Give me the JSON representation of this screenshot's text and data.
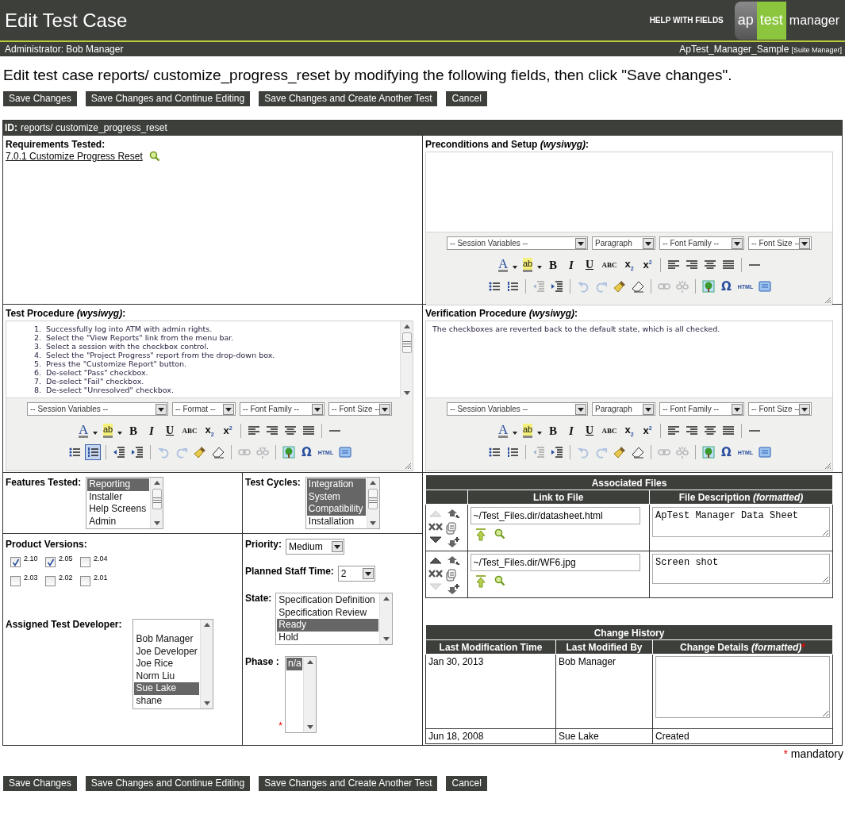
{
  "header": {
    "title": "Edit Test Case",
    "help_link": "HELP WITH FIELDS",
    "logo": [
      "ap",
      "test",
      "manager"
    ]
  },
  "user_bar": {
    "user": "Administrator: Bob Manager",
    "project": "ApTest_Manager_Sample",
    "role": "[Suite Manager]"
  },
  "instruction": "Edit test case reports/ customize_progress_reset by modifying the following fields, then click \"Save changes\".",
  "top_buttons": [
    "Save Changes",
    "Save Changes and Continue Editing",
    "Save Changes and Create Another Test",
    "Cancel"
  ],
  "form": {
    "id_label": "ID:",
    "id_value": "reports/ customize_progress_reset",
    "requirements": {
      "label": "Requirements Tested:",
      "link": "7.0.1 Customize Progress Reset"
    },
    "preconditions": {
      "label": "Preconditions and Setup *(wysiwyg)*:",
      "selects": [
        "-- Session Variables --",
        "Paragraph",
        "-- Font Family --",
        "-- Font Size --"
      ],
      "toolbar_rows": [
        [
          [
            {
              "kind": "color",
              "text": "A",
              "disabled": false,
              "active": false
            },
            {
              "kind": "highlight",
              "text": "ab",
              "disabled": false,
              "active": false
            },
            {
              "kind": "bold",
              "text": "B",
              "disabled": false,
              "active": false
            },
            {
              "kind": "italic",
              "text": "I",
              "disabled": false,
              "active": false
            },
            {
              "kind": "underline",
              "text": "U",
              "disabled": false,
              "active": false
            },
            {
              "kind": "strike",
              "text": "ABC",
              "disabled": false,
              "active": false
            },
            {
              "kind": "sub",
              "text": "x$_{2}$",
              "disabled": false,
              "active": false
            },
            {
              "kind": "sup",
              "text": "x$^{2}$",
              "disabled": false,
              "active": false
            }
          ],
          [
            {
              "kind": "left",
              "disabled": false,
              "active": false
            },
            {
              "kind": "right",
              "disabled": false,
              "active": false
            },
            {
              "kind": "center",
              "disabled": false,
              "active": false
            },
            {
              "kind": "justify",
              "disabled": false,
              "active": false
            }
          ],
          [
            {
              "kind": "rule",
              "disabled": false,
              "active": false
            }
          ]
        ],
        [
          [
            {
              "kind": "bullets",
              "disabled": false,
              "active": false
            },
            {
              "kind": "numbers",
              "disabled": false,
              "active": false
            }
          ],
          [
            {
              "kind": "outdent",
              "disabled": true,
              "active": false
            },
            {
              "kind": "indent",
              "disabled": false,
              "active": false
            }
          ],
          [
            {
              "kind": "undo",
              "disabled": true,
              "active": false
            },
            {
              "kind": "redo",
              "disabled": true,
              "active": false
            },
            {
              "kind": "cleanup",
              "disabled": false,
              "active": false
            },
            {
              "kind": "erase",
              "disabled": false,
              "active": false
            }
          ],
          [
            {
              "kind": "link",
              "disabled": true,
              "active": false
            },
            {
              "kind": "unlink",
              "disabled": true,
              "active": false
            }
          ],
          [
            {
              "kind": "image",
              "disabled": false,
              "active": false
            },
            {
              "kind": "symbol",
              "text": "Ω",
              "disabled": false,
              "active": false
            },
            {
              "kind": "html",
              "text": "HTML",
              "disabled": false,
              "active": false
            },
            {
              "kind": "fullscreen",
              "disabled": false,
              "active": false
            }
          ]
        ]
      ]
    },
    "test_procedure": {
      "label": "Test Procedure *(wysiwyg)*:",
      "steps": [
        {
          "number": "1.",
          "text": "Successfully log into ATM with admin rights."
        },
        {
          "number": "2.",
          "text": "Select the \"View Reports\" link from the menu bar."
        },
        {
          "number": "3.",
          "text": "Select a session with the checkbox control."
        },
        {
          "number": "4.",
          "text": "Select the \"Project Progress\" report from the drop-down box."
        },
        {
          "number": "5.",
          "text": "Press the \"Customize Report\" button."
        },
        {
          "number": "6.",
          "text": "De-select \"Pass\" checkbox."
        },
        {
          "number": "7.",
          "text": "De-select \"Fail\" checkbox."
        },
        {
          "number": "8.",
          "text": "De-select \"Unresolved\" checkbox."
        }
      ],
      "selects": [
        "-- Session Variables --",
        "-- Format --",
        "-- Font Family --",
        "-- Font Size --"
      ],
      "toolbar_rows": [
        [
          [
            {
              "kind": "color",
              "text": "A",
              "disabled": false,
              "active": false
            },
            {
              "kind": "highlight",
              "text": "ab",
              "disabled": false,
              "active": false
            },
            {
              "kind": "bold",
              "text": "B",
              "disabled": false,
              "active": false
            },
            {
              "kind": "italic",
              "text": "I",
              "disabled": false,
              "active": false
            },
            {
              "kind": "underline",
              "text": "U",
              "disabled": false,
              "active": false
            },
            {
              "kind": "strike",
              "text": "ABC",
              "disabled": false,
              "active": false
            },
            {
              "kind": "sub",
              "text": "x$_{2}$",
              "disabled": false,
              "active": false
            },
            {
              "kind": "sup",
              "text": "x$^{2}$",
              "disabled": false,
              "active": false
            }
          ],
          [
            {
              "kind": "left",
              "disabled": false,
              "active": false
            },
            {
              "kind": "right",
              "disabled": false,
              "active": false
            },
            {
              "kind": "center",
              "disabled": false,
              "active": false
            },
            {
              "kind": "justify",
              "disabled": false,
              "active": false
            }
          ],
          [
            {
              "kind": "rule",
              "disabled": false,
              "active": false
            }
          ]
        ],
        [
          [
            {
              "kind": "bullets",
              "disabled": false,
              "active": false
            },
            {
              "kind": "numbers",
              "disabled": false,
              "active": true
            }
          ],
          [
            {
              "kind": "outdent",
              "disabled": false,
              "active": false
            },
            {
              "kind": "indent",
              "disabled": false,
              "active": false
            }
          ],
          [
            {
              "kind": "undo",
              "disabled": true,
              "active": false
            },
            {
              "kind": "redo",
              "disabled": true,
              "active": false
            },
            {
              "kind": "cleanup",
              "disabled": false,
              "active": false
            },
            {
              "kind": "erase",
              "disabled": false,
              "active": false
            }
          ],
          [
            {
              "kind": "link",
              "disabled": true,
              "active": false
            },
            {
              "kind": "unlink",
              "disabled": true,
              "active": false
            }
          ],
          [
            {
              "kind": "image",
              "disabled": false,
              "active": false
            },
            {
              "kind": "symbol",
              "text": "Ω",
              "disabled": false,
              "active": false
            },
            {
              "kind": "html",
              "text": "HTML",
              "disabled": false,
              "active": false
            },
            {
              "kind": "fullscreen",
              "disabled": false,
              "active": false
            }
          ]
        ]
      ]
    },
    "verification": {
      "label": "Verification Procedure *(wysiwyg)*:",
      "text": "The checkboxes are reverted back to the default state, which is all checked.",
      "selects": [
        "-- Session Variables --",
        "Paragraph",
        "-- Font Family --",
        "-- Font Size --"
      ],
      "toolbar_rows": [
        [
          [
            {
              "kind": "color",
              "text": "A",
              "disabled": false,
              "active": false
            },
            {
              "kind": "highlight",
              "text": "ab",
              "disabled": false,
              "active": false
            },
            {
              "kind": "bold",
              "text": "B",
              "disabled": false,
              "active": false
            },
            {
              "kind": "italic",
              "text": "I",
              "disabled": false,
              "active": false
            },
            {
              "kind": "underline",
              "text": "U",
              "disabled": false,
              "active": false
            },
            {
              "kind": "strike",
              "text": "ABC",
              "disabled": false,
              "active": false
            },
            {
              "kind": "sub",
              "text": "x$_{2}$",
              "disabled": false,
              "active": false
            },
            {
              "kind": "sup",
              "text": "x$^{2}$",
              "disabled": false,
              "active": false
            }
          ],
          [
            {
              "kind": "left",
              "disabled": false,
              "active": false
            },
            {
              "kind": "right",
              "disabled": false,
              "active": false
            },
            {
              "kind": "center",
              "disabled": false,
              "active": false
            },
            {
              "kind": "justify",
              "disabled": false,
              "active": false
            }
          ],
          [
            {
              "kind": "rule",
              "disabled": false,
              "active": false
            }
          ]
        ],
        [
          [
            {
              "kind": "bullets",
              "disabled": false,
              "active": false
            },
            {
              "kind": "numbers",
              "disabled": false,
              "active": false
            }
          ],
          [
            {
              "kind": "outdent",
              "disabled": true,
              "active": false
            },
            {
              "kind": "indent",
              "disabled": false,
              "active": false
            }
          ],
          [
            {
              "kind": "undo",
              "disabled": true,
              "active": false
            },
            {
              "kind": "redo",
              "disabled": true,
              "active": false
            },
            {
              "kind": "cleanup",
              "disabled": false,
              "active": false
            },
            {
              "kind": "erase",
              "disabled": false,
              "active": false
            }
          ],
          [
            {
              "kind": "link",
              "disabled": true,
              "active": false
            },
            {
              "kind": "unlink",
              "disabled": true,
              "active": false
            }
          ],
          [
            {
              "kind": "image",
              "disabled": false,
              "active": false
            },
            {
              "kind": "symbol",
              "text": "Ω",
              "disabled": false,
              "active": false
            },
            {
              "kind": "html",
              "text": "HTML",
              "disabled": false,
              "active": false
            },
            {
              "kind": "fullscreen",
              "disabled": false,
              "active": false
            }
          ]
        ]
      ]
    },
    "features_tested": {
      "label": "Features Tested:",
      "options": [
        {
          "label": "Reporting",
          "selected": true
        },
        {
          "label": "Installer",
          "selected": false
        },
        {
          "label": "Help Screens",
          "selected": false
        },
        {
          "label": "Admin",
          "selected": false
        }
      ]
    },
    "test_cycles": {
      "label": "Test Cycles:",
      "options": [
        {
          "label": "Integration",
          "selected": true
        },
        {
          "label": "System",
          "selected": true
        },
        {
          "label": "Compatibility",
          "selected": true
        },
        {
          "label": "Installation",
          "selected": false
        }
      ]
    },
    "product_versions": {
      "label": "Product Versions:",
      "options": [
        {
          "label": "2.10",
          "checked": true
        },
        {
          "label": "2.05",
          "checked": true
        },
        {
          "label": "2.04",
          "checked": false
        },
        {
          "label": "2.03",
          "checked": false
        },
        {
          "label": "2.02",
          "checked": false
        },
        {
          "label": "2.01",
          "checked": false
        }
      ]
    },
    "assigned_developer": {
      "label": "Assigned Test Developer:",
      "options": [
        {
          "label": "Bob Manager",
          "selected": false
        },
        {
          "label": "Joe Developer",
          "selected": false
        },
        {
          "label": "Joe Rice",
          "selected": false
        },
        {
          "label": "Norm Liu",
          "selected": false
        },
        {
          "label": "Sue Lake",
          "selected": true
        },
        {
          "label": "shane",
          "selected": false
        }
      ]
    },
    "priority": {
      "label": "Priority:",
      "value": "Medium"
    },
    "planned_staff_time": {
      "label": "Planned Staff Time:",
      "value": "2"
    },
    "state": {
      "label": "State:",
      "options": [
        {
          "label": "Specification Definition",
          "selected": false
        },
        {
          "label": "Specification Review",
          "selected": false
        },
        {
          "label": "Ready",
          "selected": true
        },
        {
          "label": "Hold",
          "selected": false
        }
      ]
    },
    "phase": {
      "label": "Phase :",
      "mandatory_mark": "*",
      "options": [
        {
          "label": "n/a",
          "selected": true
        }
      ]
    },
    "associated_files": {
      "title": "Associated Files",
      "columns": [
        "Link to File",
        "File Description *(formatted)*"
      ],
      "rows": [
        {
          "can_move_up": false,
          "can_move_down": true,
          "link": "~/Test_Files.dir/datasheet.html",
          "description": "ApTest Manager Data Sheet"
        },
        {
          "can_move_up": true,
          "can_move_down": false,
          "link": "~/Test_Files.dir/WF6.jpg",
          "description": "Screen shot"
        }
      ]
    },
    "change_history": {
      "title": "Change History",
      "columns": [
        {
          "label": "Last Modification Time"
        },
        {
          "label": "Last Modified By"
        },
        {
          "label": "Change Details *(formatted)*",
          "mandatory_mark": "*"
        }
      ],
      "rows": [
        {
          "kind": "edit",
          "time": "Jan 30, 2013",
          "by": "Bob Manager"
        },
        {
          "kind": "text",
          "time": "Jun 18, 2008",
          "by": "Sue Lake",
          "details": "Created"
        }
      ]
    }
  },
  "mandatory_note": {
    "mark": "*",
    "text": "mandatory"
  },
  "bottom_buttons": [
    "Save Changes",
    "Save Changes and Continue Editing",
    "Save Changes and Create Another Test",
    "Cancel"
  ]
}
